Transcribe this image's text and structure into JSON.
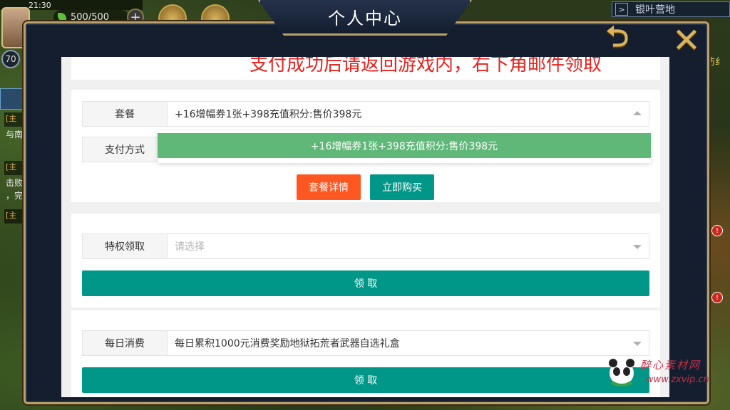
{
  "status_bar": {
    "time": "21:30"
  },
  "hud": {
    "energy": "500/500",
    "plus": "+",
    "level": "70"
  },
  "location": {
    "arrow": ">",
    "name": "银叶营地"
  },
  "quest_tags": [
    "[主",
    "[主",
    "[主"
  ],
  "quest_lines": [
    "与南",
    "击败",
    "，完"
  ],
  "right_side": {
    "label": "防纟",
    "alert": "!"
  },
  "modal": {
    "title": "个人中心",
    "back_icon": "⮌",
    "close_icon": "✕"
  },
  "notice": "支付成功后请返回游戏内，右下角邮件领取",
  "purchase": {
    "package_label": "套餐",
    "package_value": "+16增幅券1张+398充值积分:售价398元",
    "dropdown_option": "+16增幅券1张+398充值积分:售价398元",
    "payment_label": "支付方式",
    "details_button": "套餐详情",
    "buy_button": "立即购买"
  },
  "privilege": {
    "label": "特权领取",
    "placeholder": "请选择",
    "claim_button": "领 取"
  },
  "daily": {
    "label": "每日消费",
    "value": "每日累积1000元消费奖励地狱拓荒者武器自选礼盒",
    "claim_button": "领 取"
  },
  "watermark": {
    "title": "醉心素材网",
    "url": "www.zxvip.cn"
  },
  "colors": {
    "accent_teal": "#009688",
    "accent_orange": "#ff5722",
    "option_green": "#5fb878",
    "notice_red": "#e8231e",
    "frame_gold": "#b9a26a"
  }
}
